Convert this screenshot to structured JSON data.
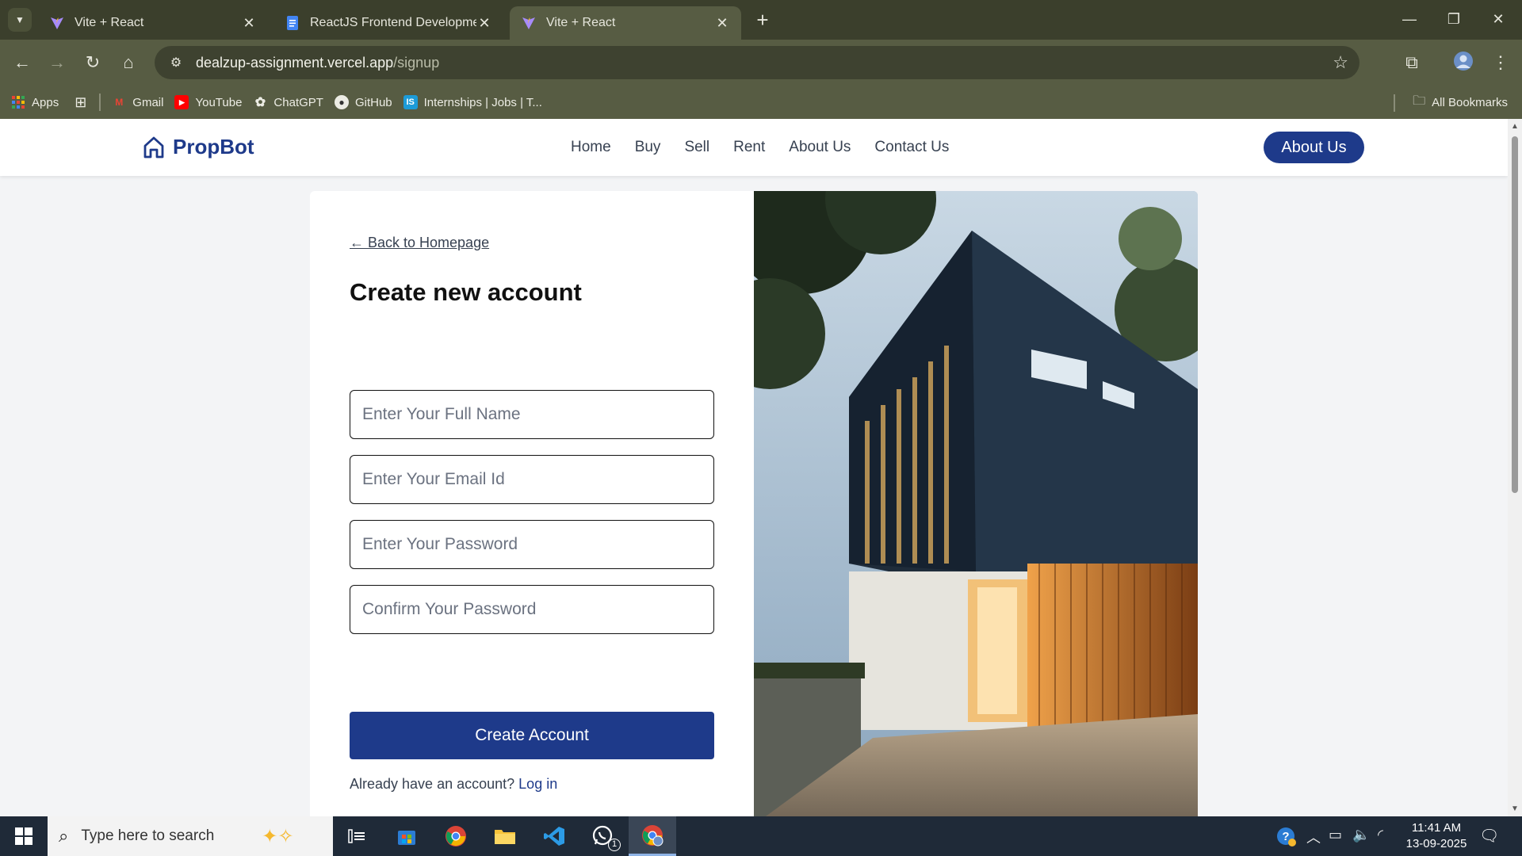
{
  "browser": {
    "tabs": [
      {
        "title": "Vite + React",
        "active": false,
        "icon": "vite-icon"
      },
      {
        "title": "ReactJS Frontend Development",
        "active": false,
        "icon": "docs-icon"
      },
      {
        "title": "Vite + React",
        "active": true,
        "icon": "vite-icon"
      }
    ],
    "url_host": "dealzup-assignment.vercel.app",
    "url_path": "/signup",
    "bookmarks": [
      {
        "label": "Apps",
        "icon": "apps-grid-icon"
      },
      {
        "label": "Gmail",
        "icon": "gmail-icon"
      },
      {
        "label": "YouTube",
        "icon": "youtube-icon"
      },
      {
        "label": "ChatGPT",
        "icon": "chatgpt-icon"
      },
      {
        "label": "GitHub",
        "icon": "github-icon"
      },
      {
        "label": "Internships | Jobs | T...",
        "icon": "internshala-icon"
      }
    ],
    "all_bookmarks": "All Bookmarks"
  },
  "site": {
    "brand": "PropBot",
    "nav": [
      "Home",
      "Buy",
      "Sell",
      "Rent",
      "About Us",
      "Contact Us"
    ],
    "header_button": "About Us",
    "colors": {
      "primary": "#1e3a8a"
    }
  },
  "signup": {
    "back_link": "← Back to Homepage",
    "title": "Create new account",
    "fields": {
      "full_name": "Enter Your Full Name",
      "email": "Enter Your Email Id",
      "password": "Enter Your Password",
      "confirm_password": "Confirm Your Password"
    },
    "submit": "Create Account",
    "login_prompt": "Already have an account?",
    "login_link": "Log in",
    "image": "modern-house-photo"
  },
  "taskbar": {
    "search_placeholder": "Type here to search",
    "time": "11:41 AM",
    "date": "13-09-2025",
    "whatsapp_badge": "1"
  }
}
